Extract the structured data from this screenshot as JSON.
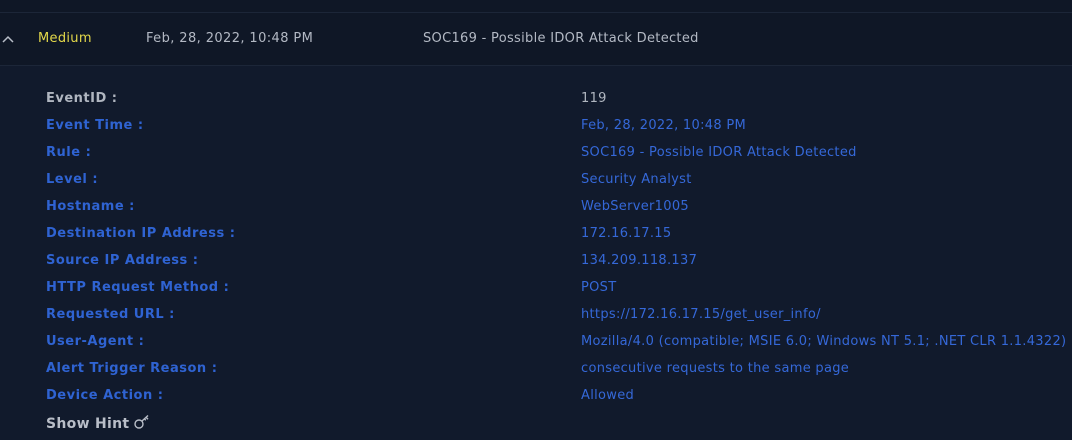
{
  "alert": {
    "collapse_icon": "chevron-up-icon",
    "severity": "Medium",
    "severity_color": "#e3d84a",
    "time": "Feb, 28, 2022, 10:48 PM",
    "title": "SOC169 - Possible IDOR Attack Detected"
  },
  "details": {
    "fields": [
      {
        "label": "EventID :",
        "value": "119"
      },
      {
        "label": "Event Time :",
        "value": "Feb, 28, 2022, 10:48 PM"
      },
      {
        "label": "Rule :",
        "value": "SOC169 - Possible IDOR Attack Detected"
      },
      {
        "label": "Level :",
        "value": "Security Analyst"
      },
      {
        "label": "Hostname :",
        "value": "WebServer1005"
      },
      {
        "label": "Destination IP Address :",
        "value": "172.16.17.15"
      },
      {
        "label": "Source IP Address :",
        "value": "134.209.118.137"
      },
      {
        "label": "HTTP Request Method :",
        "value": "POST"
      },
      {
        "label": "Requested URL :",
        "value": "https://172.16.17.15/get_user_info/"
      },
      {
        "label": "User-Agent :",
        "value": "Mozilla/4.0 (compatible; MSIE 6.0; Windows NT 5.1; .NET CLR 1.1.4322)"
      },
      {
        "label": "Alert Trigger Reason :",
        "value": "consecutive requests to the same page"
      },
      {
        "label": "Device Action :",
        "value": "Allowed"
      }
    ],
    "hint_label": "Show Hint",
    "hint_icon": "key-icon"
  },
  "colors": {
    "background": "#0f1726",
    "accent_blue": "#3568d8",
    "text_gray": "#b0b6c0"
  }
}
